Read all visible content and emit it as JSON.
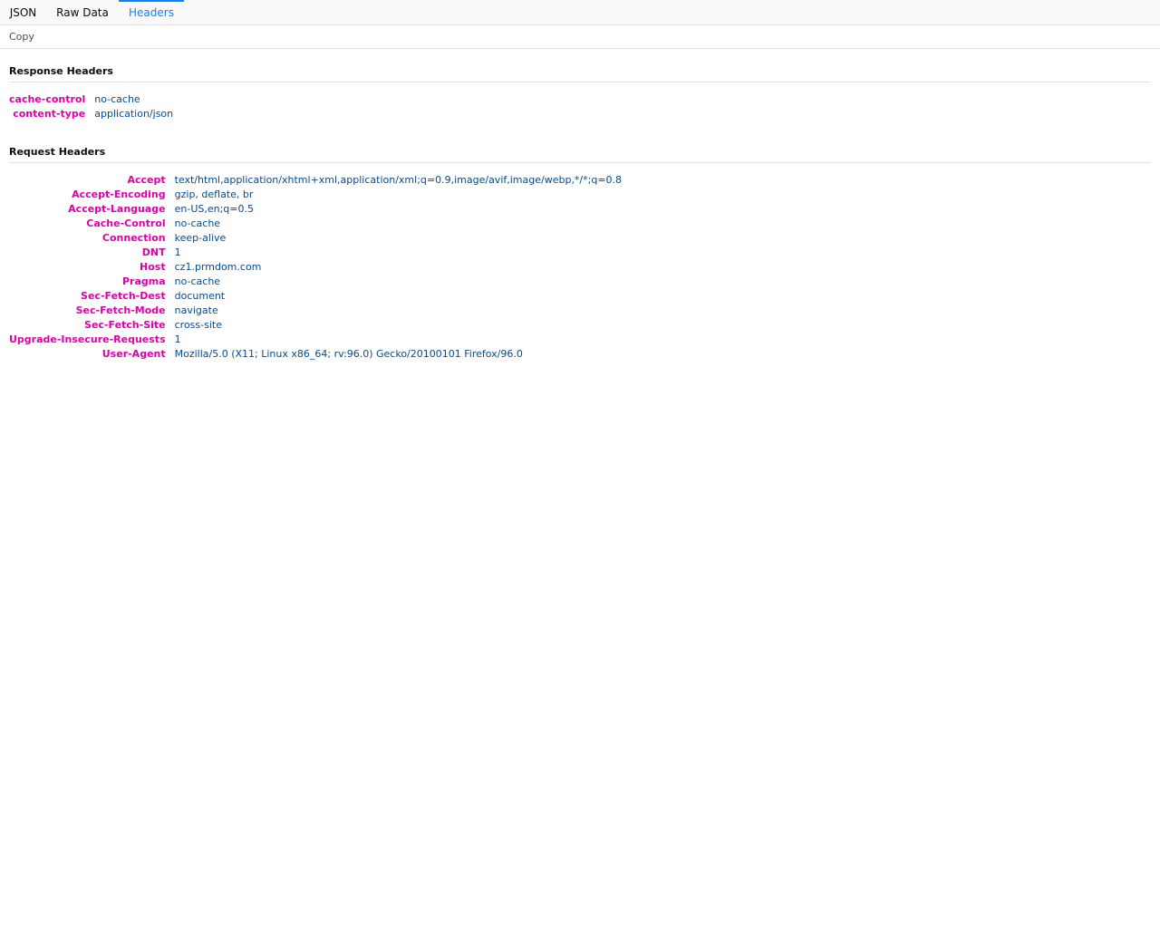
{
  "tabs": [
    {
      "label": "JSON"
    },
    {
      "label": "Raw Data"
    },
    {
      "label": "Headers"
    }
  ],
  "toolbar": {
    "copy_label": "Copy"
  },
  "response": {
    "title": "Response Headers",
    "headers": [
      {
        "name": "cache-control",
        "value": "no-cache"
      },
      {
        "name": "content-type",
        "value": "application/json"
      }
    ]
  },
  "request": {
    "title": "Request Headers",
    "headers": [
      {
        "name": "Accept",
        "value": "text/html,application/xhtml+xml,application/xml;q=0.9,image/avif,image/webp,*/*;q=0.8"
      },
      {
        "name": "Accept-Encoding",
        "value": "gzip, deflate, br"
      },
      {
        "name": "Accept-Language",
        "value": "en-US,en;q=0.5"
      },
      {
        "name": "Cache-Control",
        "value": "no-cache"
      },
      {
        "name": "Connection",
        "value": "keep-alive"
      },
      {
        "name": "DNT",
        "value": "1"
      },
      {
        "name": "Host",
        "value": "cz1.prmdom.com"
      },
      {
        "name": "Pragma",
        "value": "no-cache"
      },
      {
        "name": "Sec-Fetch-Dest",
        "value": "document"
      },
      {
        "name": "Sec-Fetch-Mode",
        "value": "navigate"
      },
      {
        "name": "Sec-Fetch-Site",
        "value": "cross-site"
      },
      {
        "name": "Upgrade-Insecure-Requests",
        "value": "1"
      },
      {
        "name": "User-Agent",
        "value": "Mozilla/5.0 (X11; Linux x86_64; rv:96.0) Gecko/20100101 Firefox/96.0"
      }
    ]
  },
  "colors": {
    "active_tab": "#0a84ff",
    "header_name": "#dd00a9",
    "header_value": "#074a8b"
  }
}
